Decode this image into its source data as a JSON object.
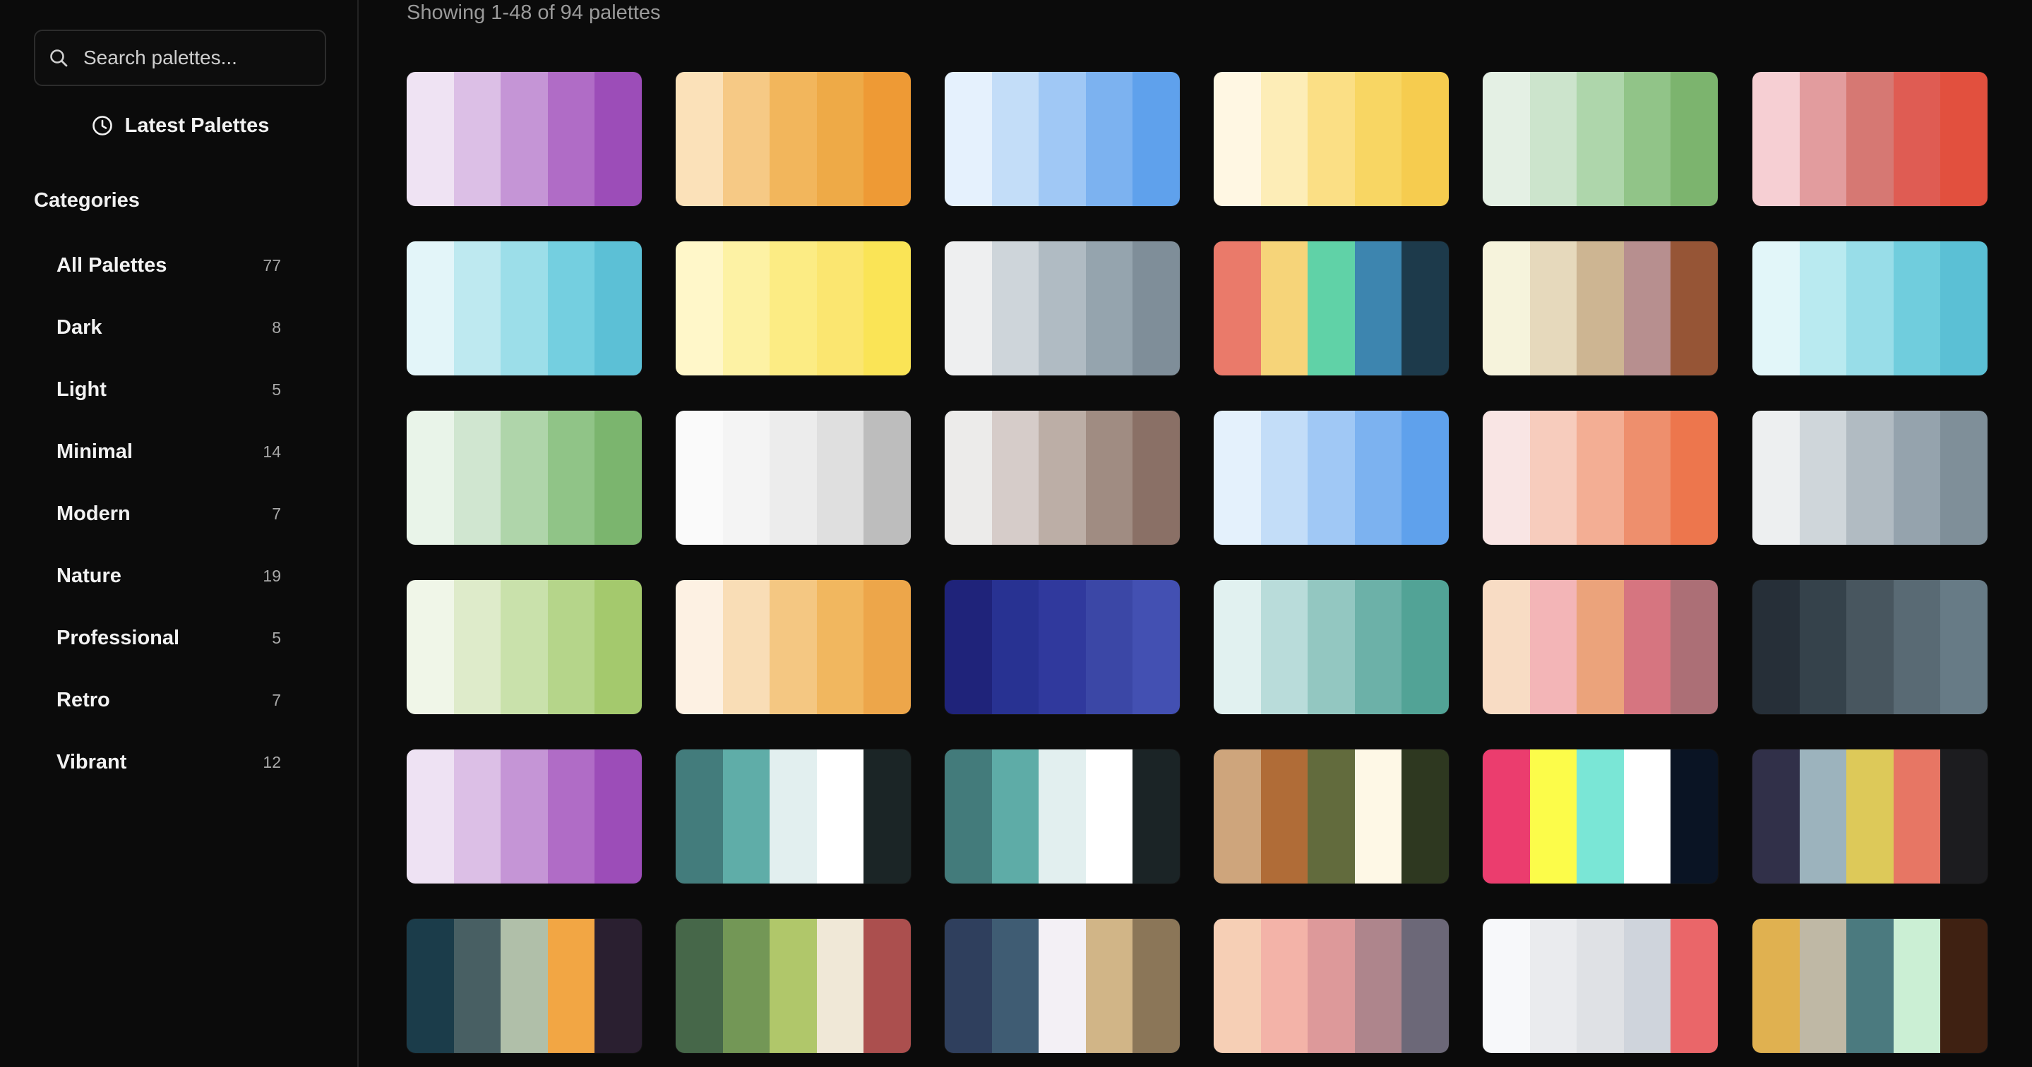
{
  "search": {
    "placeholder": "Search palettes...",
    "icon": "search-icon"
  },
  "latest_button": {
    "label": "Latest Palettes",
    "icon": "clock-icon"
  },
  "categories": {
    "heading": "Categories",
    "items": [
      {
        "name": "All Palettes",
        "count": "77"
      },
      {
        "name": "Dark",
        "count": "8"
      },
      {
        "name": "Light",
        "count": "5"
      },
      {
        "name": "Minimal",
        "count": "14"
      },
      {
        "name": "Modern",
        "count": "7"
      },
      {
        "name": "Nature",
        "count": "19"
      },
      {
        "name": "Professional",
        "count": "5"
      },
      {
        "name": "Retro",
        "count": "7"
      },
      {
        "name": "Vibrant",
        "count": "12"
      }
    ]
  },
  "main": {
    "showing_text": "Showing 1-48 of 94 palettes"
  },
  "palettes": [
    [
      "#efe3f3",
      "#dcbfe6",
      "#c595d6",
      "#b06cc6",
      "#9c4db8"
    ],
    [
      "#fbe1b9",
      "#f6c985",
      "#f2b65c",
      "#eeaa47",
      "#ee9a35"
    ],
    [
      "#e5f1fd",
      "#c3ddf8",
      "#a0c8f5",
      "#7cb2f0",
      "#5fa1ec"
    ],
    [
      "#fff7e3",
      "#fdedb7",
      "#fbdf85",
      "#f8d663",
      "#f6cc4f"
    ],
    [
      "#e4f0e4",
      "#cce4cc",
      "#aed6ab",
      "#91c488",
      "#7cb46e"
    ],
    [
      "#f6cfd3",
      "#e29c9e",
      "#d67873",
      "#df5c53",
      "#e2503e"
    ],
    [
      "#e3f5f9",
      "#bee9f0",
      "#9cdee9",
      "#74cfe0",
      "#5cc0d6"
    ],
    [
      "#fff7c9",
      "#fdf2a4",
      "#fcec84",
      "#fbe670",
      "#fae456"
    ],
    [
      "#eeeff0",
      "#ced5da",
      "#b0bbc3",
      "#95a4ae",
      "#7f8e99"
    ],
    [
      "#ea7a6a",
      "#f6d479",
      "#60d2a7",
      "#3d85af",
      "#1d3a4b"
    ],
    [
      "#f6f3dc",
      "#e6d9bc",
      "#cdb592",
      "#b78f8f",
      "#965536"
    ],
    [
      "#e2f6f9",
      "#b9eaf0",
      "#98dde8",
      "#70cddd",
      "#5bc0d5"
    ],
    [
      "#e9f4e9",
      "#d0e6d0",
      "#afd5aa",
      "#90c487",
      "#7bb56e"
    ],
    [
      "#fafafa",
      "#f4f4f4",
      "#ececec",
      "#dfdfdf",
      "#bdbdbd"
    ],
    [
      "#ecebea",
      "#d6ccc9",
      "#bcaea6",
      "#a08c82",
      "#8a7066"
    ],
    [
      "#e4f1fc",
      "#c3ddf8",
      "#a0c8f5",
      "#7cb2f0",
      "#5fa1ec"
    ],
    [
      "#f9e5e4",
      "#f7ccbd",
      "#f3ae94",
      "#ee8f6d",
      "#ed764d"
    ],
    [
      "#edeff0",
      "#cfd6da",
      "#b1bbc2",
      "#95a3ad",
      "#7f8f99"
    ],
    [
      "#f0f6e8",
      "#deebca",
      "#c9e1ab",
      "#b5d58a",
      "#a4c96d"
    ],
    [
      "#fdf1e3",
      "#f9ddb6",
      "#f4c782",
      "#f1b75f",
      "#eda64a"
    ],
    [
      "#1f237a",
      "#283292",
      "#30399d",
      "#3b47a6",
      "#4350b2"
    ],
    [
      "#e1f1f0",
      "#b9dcda",
      "#93c7c1",
      "#6cb1a8",
      "#52a396"
    ],
    [
      "#f8dcc4",
      "#f3b5b7",
      "#eba37b",
      "#d67580",
      "#ac6f76"
    ],
    [
      "#262f38",
      "#35424b",
      "#48565f",
      "#596a74",
      "#677b86"
    ],
    [
      "#eee2f3",
      "#dcbfe6",
      "#c595d6",
      "#b06cc6",
      "#9c4db8"
    ],
    [
      "#437c7c",
      "#5fada8",
      "#e2efef",
      "#ffffff",
      "#1b2526"
    ],
    [
      "#437b7b",
      "#5eaca7",
      "#e2efef",
      "#ffffff",
      "#1b2426"
    ],
    [
      "#cea57c",
      "#b06c37",
      "#626b3d",
      "#fef8e6",
      "#2e3820"
    ],
    [
      "#eb3d6e",
      "#fcfc4a",
      "#7ae6d6",
      "#ffffff",
      "#0a1424"
    ],
    [
      "#313049",
      "#9cb3bd",
      "#ddc959",
      "#e77664",
      "#1c1c1f"
    ],
    [
      "#1b3c4a",
      "#485f63",
      "#b0bfa9",
      "#f2a644",
      "#2a1f30"
    ],
    [
      "#466749",
      "#739756",
      "#b0c76a",
      "#f0e8d7",
      "#ab4f4e"
    ],
    [
      "#2f3f5d",
      "#3f5c73",
      "#f3f0f5",
      "#d1b587",
      "#8b7658"
    ],
    [
      "#f6cfb5",
      "#f3b3a8",
      "#dd999a",
      "#ae858c",
      "#6c6878"
    ],
    [
      "#f7f8fa",
      "#eaebee",
      "#dfe1e5",
      "#cfd4dc",
      "#ea6669"
    ],
    [
      "#e0b150",
      "#bfb8a5",
      "#4b7a7f",
      "#cbefd4",
      "#3f2112"
    ]
  ]
}
